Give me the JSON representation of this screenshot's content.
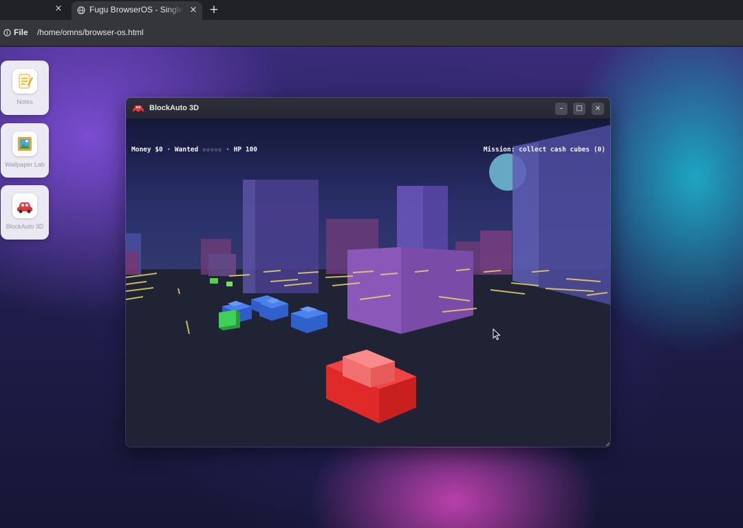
{
  "browser": {
    "prev_tab_close": "×",
    "active_tab": {
      "title": "Fugu BrowserOS - Single",
      "close": "×"
    },
    "new_tab": "+",
    "address": {
      "scheme": "File",
      "url": "/home/omns/browser-os.html"
    }
  },
  "desktop": {
    "dock": [
      {
        "label": "Notes",
        "icon": "notepad-icon",
        "glyph": "📝"
      },
      {
        "label": "Wallpaper Lab",
        "icon": "picture-icon",
        "glyph": "🖼️"
      },
      {
        "label": "BlockAuto 3D",
        "icon": "car-icon",
        "glyph": "🚗"
      }
    ]
  },
  "window": {
    "title": "BlockAuto 3D",
    "icon": "car-icon",
    "buttons": {
      "minimize": "–",
      "maximize": "□",
      "close": "×"
    }
  },
  "game": {
    "hud_left": "Money $0 · Wanted ☆☆☆☆☆ · HP 100",
    "hud_right": "Mission: collect cash cubes (0)",
    "money": 0,
    "wanted_stars": 0,
    "hp": 100,
    "cash_collected": 0,
    "colors": {
      "sky_top": "#1a1f4a",
      "ground": "#1e2235",
      "player_car": "#e8302f",
      "npc_car": "#3a6fd8",
      "cash_cube": "#33cc55",
      "building": "#5a3f9c",
      "road_marks": "#e8d36a",
      "moon": "#6fb7d0"
    }
  }
}
